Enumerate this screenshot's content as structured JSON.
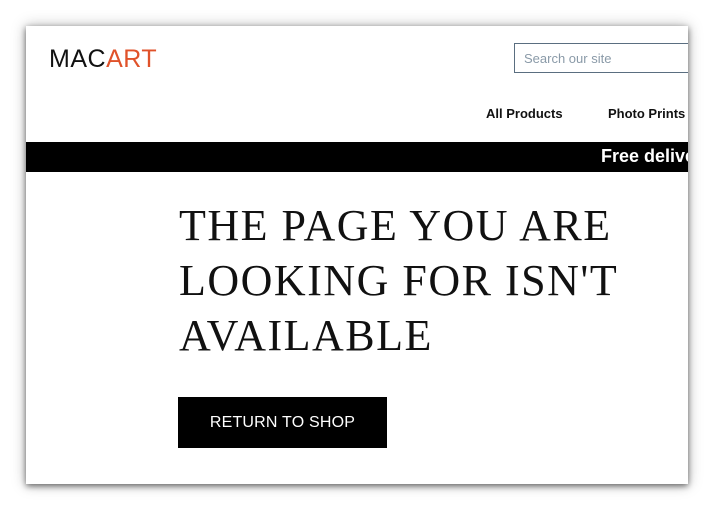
{
  "colors": {
    "accent": "#e0522a",
    "black": "#000000",
    "white": "#ffffff"
  },
  "brand": {
    "logo_part1": "MAC",
    "logo_part2": "ART"
  },
  "header": {
    "search_placeholder": "Search our site"
  },
  "nav": {
    "items": [
      {
        "label": "All Products"
      },
      {
        "label": "Photo Prints"
      }
    ]
  },
  "banner": {
    "text": "Free delive"
  },
  "main": {
    "headline": "THE PAGE YOU ARE LOOKING FOR ISN'T AVAILABLE",
    "button_label": "RETURN TO SHOP"
  }
}
